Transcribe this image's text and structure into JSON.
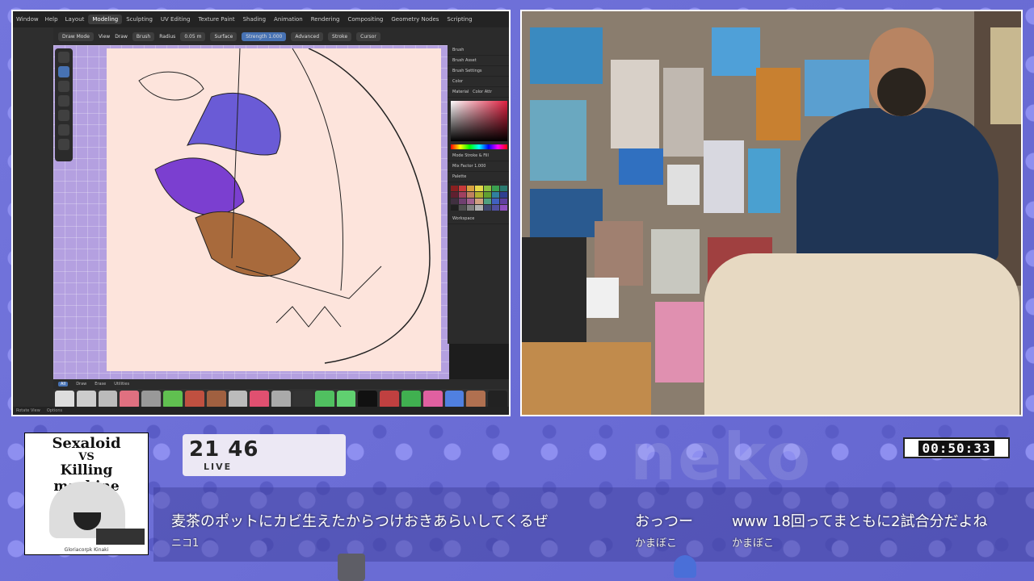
{
  "background": {
    "watermark": "neko"
  },
  "blender": {
    "menu": [
      "Window",
      "Help"
    ],
    "workspace_tabs": [
      "Layout",
      "Modeling",
      "Sculpting",
      "UV Editing",
      "Texture Paint",
      "Shading",
      "Animation",
      "Rendering",
      "Compositing",
      "Geometry Nodes",
      "Scripting"
    ],
    "active_tab": "Modeling",
    "tool_header": {
      "mode": "Draw Mode",
      "view": "View",
      "draw": "Draw",
      "brush": "Brush",
      "radius_label": "Radius",
      "radius_value": "0.05 m",
      "surface": "Surface",
      "strength": "Strength",
      "strength_value": "1.000",
      "advanced": "Advanced",
      "stroke": "Stroke",
      "cursor": "Cursor"
    },
    "side_panel": {
      "sections": [
        "Brush",
        "Brush Asset",
        "Brush Settings",
        "Color",
        "Palette",
        "Workspace"
      ],
      "color_tabs": [
        "Material",
        "Color Attr"
      ],
      "mix_factor_label": "Mix Factor",
      "mix_factor_value": "1.000",
      "mode_label": "Mode",
      "mode_value": "Stroke & Fill"
    },
    "brush_bar": [
      "All",
      "Draw",
      "Erase",
      "Utilities"
    ],
    "brush_bar_active": "All",
    "status_bar": [
      "Rotate View",
      "Options"
    ]
  },
  "stream": {
    "cover": {
      "title_line1": "Sexaloid",
      "title_line2": "VS",
      "title_line3": "Killing machine",
      "credit": "Gloriacorpk Kinaki"
    },
    "viewer_count": "21 46",
    "live_label": "LIVE",
    "timer": "00:50:33"
  },
  "comments": [
    {
      "text": "麦茶のポットにカビ生えたからつけおきあらいしてくるぜ",
      "user": "ニコ1"
    },
    {
      "text": "おっつー",
      "user": "かまぼこ"
    },
    {
      "text": "www 18回ってまともに2試合分だよね",
      "user": "かまぼこ"
    }
  ],
  "colors": {
    "accent": "#4772b3",
    "background": "#6e6fd6",
    "canvas": "#fde4dc"
  }
}
